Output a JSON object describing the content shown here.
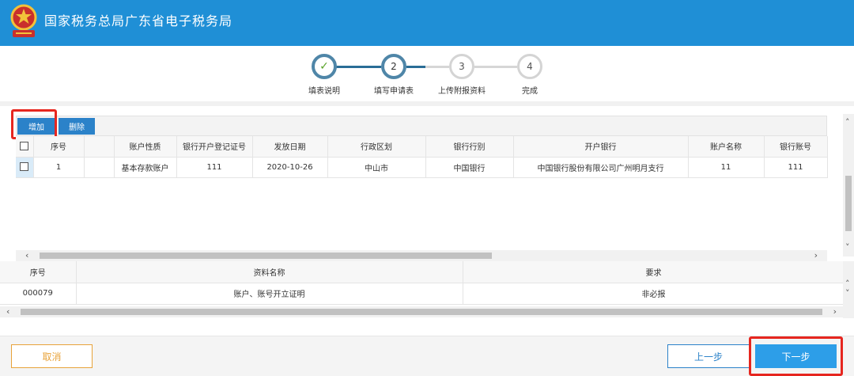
{
  "header": {
    "title": "国家税务总局广东省电子税务局"
  },
  "steps": [
    {
      "number": "✓",
      "label": "填表说明",
      "state": "done"
    },
    {
      "number": "2",
      "label": "填写申请表",
      "state": "active"
    },
    {
      "number": "3",
      "label": "上传附报资料",
      "state": "todo"
    },
    {
      "number": "4",
      "label": "完成",
      "state": "todo"
    }
  ],
  "toolbar": {
    "add_label": "增加",
    "delete_label": "删除"
  },
  "account_grid": {
    "columns": [
      "序号",
      "账户性质",
      "银行开户登记证号",
      "发放日期",
      "行政区划",
      "银行行别",
      "开户银行",
      "账户名称",
      "银行账号"
    ],
    "rows": [
      {
        "index": "1",
        "nature": "基本存款账户",
        "reg_no": "111",
        "issue_date": "2020-10-26",
        "region": "中山市",
        "bank_type": "中国银行",
        "bank_name": "中国银行股份有限公司广州明月支行",
        "account_name": "11",
        "account_no": "111"
      }
    ]
  },
  "materials_grid": {
    "columns": [
      "序号",
      "资料名称",
      "要求"
    ],
    "rows": [
      {
        "code": "000079",
        "name": "账户、账号开立证明",
        "requirement": "非必报"
      }
    ]
  },
  "footer": {
    "cancel_label": "取消",
    "prev_label": "上一步",
    "next_label": "下一步"
  },
  "colors": {
    "header_bg": "#1f8fd6",
    "primary": "#2b82c9",
    "highlight": "#e6261f",
    "cancel": "#e8a33a"
  }
}
